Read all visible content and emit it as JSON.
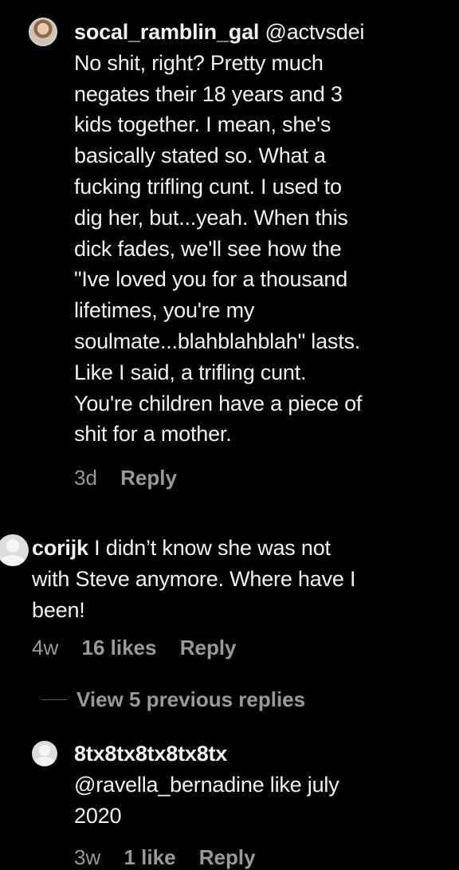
{
  "comments": [
    {
      "username": "socal_ramblin_gal",
      "mention": "@actvsdei",
      "lines": [
        "No shit, right? Pretty much",
        "negates their 18 years and 3",
        "kids together. I mean, she's",
        "basically stated so. What a",
        "fucking trifling cunt. I used to",
        "dig her, but...yeah. When this",
        "dick fades, we'll see how the",
        "\"Ive loved you for a thousand",
        "lifetimes, you're my",
        "soulmate...blahblahblah\" lasts.",
        "Like I said, a trifling cunt.",
        "You're children have a piece of",
        "shit for a mother."
      ],
      "time": "3d",
      "reply_label": "Reply"
    },
    {
      "username": "corijk",
      "first_line_rest": "I didn’t know she was not",
      "lines": [
        "with Steve anymore. Where have I",
        "been!"
      ],
      "time": "4w",
      "likes": "16 likes",
      "reply_label": "Reply"
    },
    {
      "username": "8tx8tx8tx8tx8tx",
      "lines": [
        "@ravella_bernadine like july",
        "2020"
      ],
      "time": "3w",
      "likes": "1 like",
      "reply_label": "Reply"
    }
  ],
  "view_replies_label": "View 5 previous replies"
}
